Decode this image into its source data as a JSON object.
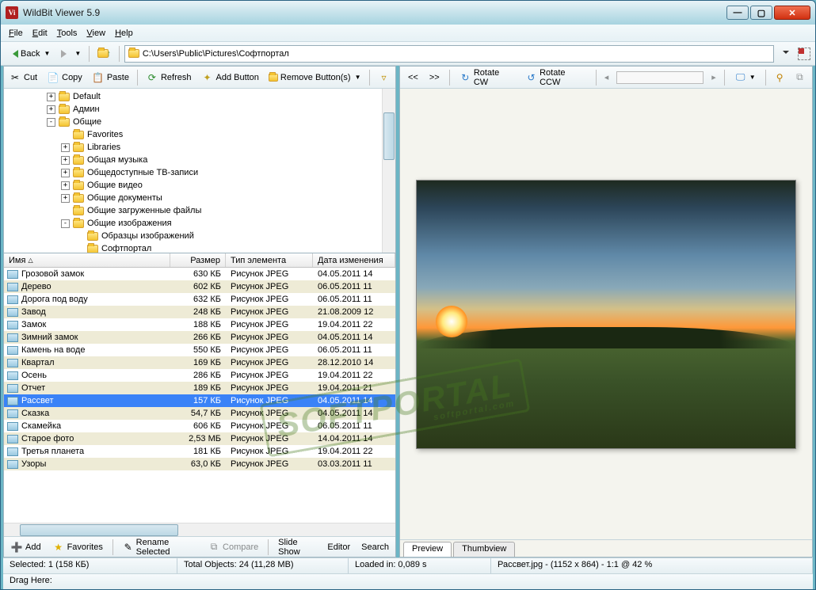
{
  "window": {
    "title": "WildBit Viewer 5.9"
  },
  "menu": [
    "File",
    "Edit",
    "Tools",
    "View",
    "Help"
  ],
  "nav": {
    "back": "Back",
    "path": "C:\\Users\\Public\\Pictures\\Софтпортал"
  },
  "toolbar": {
    "cut": "Cut",
    "copy": "Copy",
    "paste": "Paste",
    "refresh": "Refresh",
    "addbtn": "Add Button",
    "removebtn": "Remove Button(s)"
  },
  "tree": [
    {
      "level": 3,
      "exp": "+",
      "label": "Default"
    },
    {
      "level": 3,
      "exp": "+",
      "label": "Админ"
    },
    {
      "level": 3,
      "exp": "-",
      "label": "Общие"
    },
    {
      "level": 4,
      "exp": "",
      "label": "Favorites"
    },
    {
      "level": 4,
      "exp": "+",
      "label": "Libraries"
    },
    {
      "level": 4,
      "exp": "+",
      "label": "Общая музыка"
    },
    {
      "level": 4,
      "exp": "+",
      "label": "Общедоступные ТВ-записи"
    },
    {
      "level": 4,
      "exp": "+",
      "label": "Общие видео"
    },
    {
      "level": 4,
      "exp": "+",
      "label": "Общие документы"
    },
    {
      "level": 4,
      "exp": "",
      "label": "Общие загруженные файлы"
    },
    {
      "level": 4,
      "exp": "-",
      "label": "Общие изображения"
    },
    {
      "level": 5,
      "exp": "",
      "label": "Образцы изображений"
    },
    {
      "level": 5,
      "exp": "",
      "label": "Софтпортал"
    }
  ],
  "cols": {
    "name": "Имя",
    "size": "Размер",
    "type": "Тип элемента",
    "date": "Дата изменения"
  },
  "files": [
    {
      "n": "Грозовой замок",
      "s": "630 КБ",
      "t": "Рисунок JPEG",
      "d": "04.05.2011 14"
    },
    {
      "n": "Дерево",
      "s": "602 КБ",
      "t": "Рисунок JPEG",
      "d": "06.05.2011 11"
    },
    {
      "n": "Дорога под воду",
      "s": "632 КБ",
      "t": "Рисунок JPEG",
      "d": "06.05.2011 11"
    },
    {
      "n": "Завод",
      "s": "248 КБ",
      "t": "Рисунок JPEG",
      "d": "21.08.2009 12"
    },
    {
      "n": "Замок",
      "s": "188 КБ",
      "t": "Рисунок JPEG",
      "d": "19.04.2011 22"
    },
    {
      "n": "Зимний замок",
      "s": "266 КБ",
      "t": "Рисунок JPEG",
      "d": "04.05.2011 14"
    },
    {
      "n": "Камень на воде",
      "s": "550 КБ",
      "t": "Рисунок JPEG",
      "d": "06.05.2011 11"
    },
    {
      "n": "Квартал",
      "s": "169 КБ",
      "t": "Рисунок JPEG",
      "d": "28.12.2010 14"
    },
    {
      "n": "Осень",
      "s": "286 КБ",
      "t": "Рисунок JPEG",
      "d": "19.04.2011 22"
    },
    {
      "n": "Отчет",
      "s": "189 КБ",
      "t": "Рисунок JPEG",
      "d": "19.04.2011 21"
    },
    {
      "n": "Рассвет",
      "s": "157 КБ",
      "t": "Рисунок JPEG",
      "d": "04.05.2011 14",
      "sel": true
    },
    {
      "n": "Сказка",
      "s": "54,7 КБ",
      "t": "Рисунок JPEG",
      "d": "04.05.2011 14"
    },
    {
      "n": "Скамейка",
      "s": "606 КБ",
      "t": "Рисунок JPEG",
      "d": "06.05.2011 11"
    },
    {
      "n": "Старое фото",
      "s": "2,53 МБ",
      "t": "Рисунок JPEG",
      "d": "14.04.2011 14"
    },
    {
      "n": "Третья планета",
      "s": "181 КБ",
      "t": "Рисунок JPEG",
      "d": "19.04.2011 22"
    },
    {
      "n": "Узоры",
      "s": "63,0 КБ",
      "t": "Рисунок JPEG",
      "d": "03.03.2011 11"
    }
  ],
  "bbar": {
    "add": "Add",
    "fav": "Favorites",
    "rename": "Rename Selected",
    "compare": "Compare",
    "slide": "Slide Show",
    "editor": "Editor",
    "search": "Search"
  },
  "rtbar": {
    "prev": "<<",
    "next": ">>",
    "cw": "Rotate CW",
    "ccw": "Rotate CCW"
  },
  "tabs": {
    "preview": "Preview",
    "thumb": "Thumbview"
  },
  "status": {
    "sel": "Selected: 1 (158 КБ)",
    "total": "Total Objects: 24 (11,28 MB)",
    "loaded": "Loaded in: 0,089 s",
    "info": "Рассвет.jpg -  (1152 x 864) - 1:1 @ 42  %"
  },
  "drag": "Drag Here:",
  "watermark": "SOFTPORTAL",
  "watermark_sub": "softportal.com"
}
